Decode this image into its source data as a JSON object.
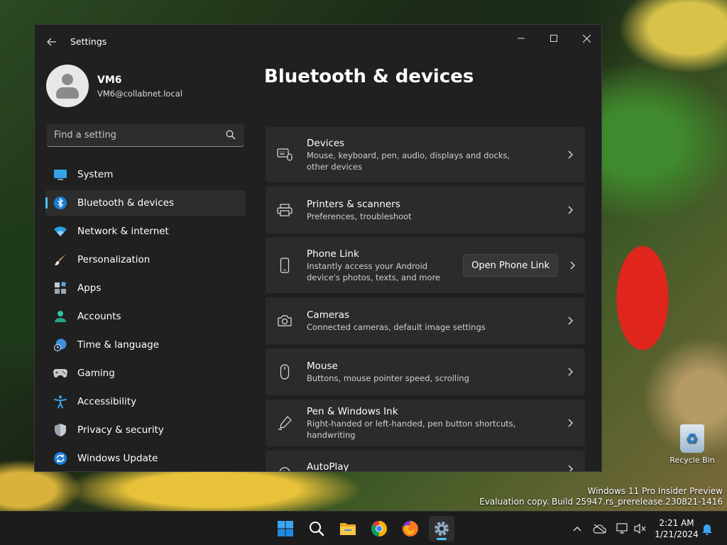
{
  "desktop": {
    "recycle_bin_label": "Recycle Bin",
    "watermark_line1": "Windows 11 Pro Insider Preview",
    "watermark_line2": "Evaluation copy. Build 25947.rs_prerelease.230821-1416"
  },
  "window": {
    "title": "Settings",
    "controls": {
      "minimize": "—",
      "close": "✕"
    }
  },
  "profile": {
    "name": "VM6",
    "email": "VM6@collabnet.local"
  },
  "search": {
    "placeholder": "Find a setting"
  },
  "nav": {
    "items": [
      {
        "label": "System",
        "icon": "system-icon"
      },
      {
        "label": "Bluetooth & devices",
        "icon": "bluetooth-icon"
      },
      {
        "label": "Network & internet",
        "icon": "wifi-icon"
      },
      {
        "label": "Personalization",
        "icon": "brush-icon"
      },
      {
        "label": "Apps",
        "icon": "apps-icon"
      },
      {
        "label": "Accounts",
        "icon": "accounts-icon"
      },
      {
        "label": "Time & language",
        "icon": "globe-clock-icon"
      },
      {
        "label": "Gaming",
        "icon": "controller-icon"
      },
      {
        "label": "Accessibility",
        "icon": "accessibility-icon"
      },
      {
        "label": "Privacy & security",
        "icon": "shield-icon"
      },
      {
        "label": "Windows Update",
        "icon": "update-icon"
      }
    ],
    "active_index": 1
  },
  "main": {
    "title": "Bluetooth & devices",
    "cards": [
      {
        "title": "Devices",
        "subtitle": "Mouse, keyboard, pen, audio, displays and docks, other devices",
        "icon": "devices-icon"
      },
      {
        "title": "Printers & scanners",
        "subtitle": "Preferences, troubleshoot",
        "icon": "printer-icon"
      },
      {
        "title": "Phone Link",
        "subtitle": "Instantly access your Android device's photos, texts, and more",
        "icon": "phone-icon",
        "button": "Open Phone Link"
      },
      {
        "title": "Cameras",
        "subtitle": "Connected cameras, default image settings",
        "icon": "camera-icon"
      },
      {
        "title": "Mouse",
        "subtitle": "Buttons, mouse pointer speed, scrolling",
        "icon": "mouse-icon"
      },
      {
        "title": "Pen & Windows Ink",
        "subtitle": "Right-handed or left-handed, pen button shortcuts, handwriting",
        "icon": "pen-icon"
      },
      {
        "title": "AutoPlay",
        "subtitle": "",
        "icon": "autoplay-icon"
      }
    ]
  },
  "taskbar": {
    "apps": [
      "start-icon",
      "search-icon",
      "file-explorer-icon",
      "chrome-icon",
      "firefox-icon",
      "settings-icon"
    ],
    "time": "2:21 AM",
    "date": "1/21/2024"
  },
  "colors": {
    "accent": "#4cc2ff",
    "window_bg": "#202020",
    "card_bg": "#2b2b2b",
    "taskbar_bg": "#1c1c1c"
  }
}
